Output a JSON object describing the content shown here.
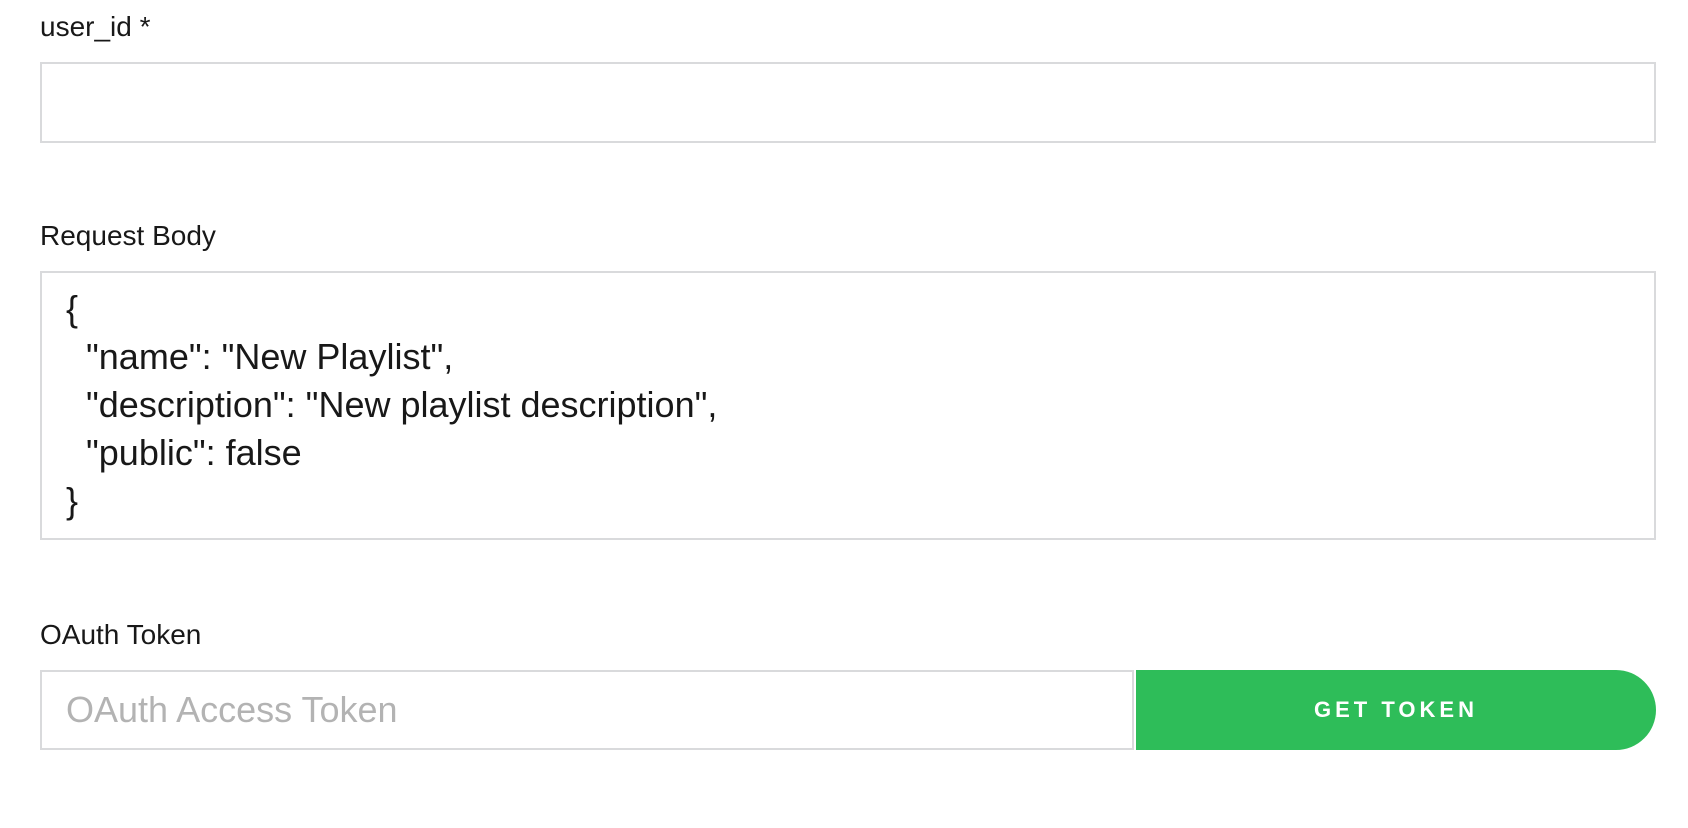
{
  "form": {
    "user_id": {
      "label": "user_id *",
      "value": "",
      "placeholder": ""
    },
    "request_body": {
      "label": "Request Body",
      "value": "{\n  \"name\": \"New Playlist\",\n  \"description\": \"New playlist description\",\n  \"public\": false\n}"
    },
    "oauth_token": {
      "label": "OAuth Token",
      "value": "",
      "placeholder": "OAuth Access Token"
    },
    "get_token_button": {
      "label": "GET TOKEN"
    }
  },
  "colors": {
    "accent": "#2ebd59",
    "border": "#d9dadc",
    "text": "#181818",
    "placeholder": "#b3b3b3"
  }
}
